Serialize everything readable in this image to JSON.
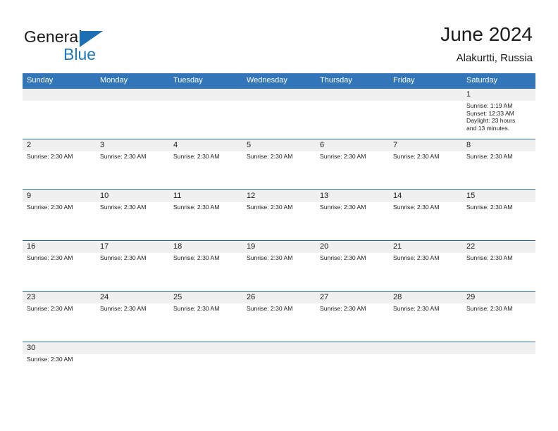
{
  "brand": {
    "name_part1": "General",
    "name_part2": "Blue",
    "logo_icon": "blue-triangle-logo"
  },
  "header": {
    "month_title": "June 2024",
    "location": "Alakurtti, Russia"
  },
  "colors": {
    "header_blue": "#3275b8",
    "row_divider_blue": "#2e6da4",
    "date_band_gray": "#f0f0f0",
    "brand_blue": "#1c7ac2",
    "text": "#1b1b1b"
  },
  "calendar": {
    "weekdays": [
      "Sunday",
      "Monday",
      "Tuesday",
      "Wednesday",
      "Thursday",
      "Friday",
      "Saturday"
    ],
    "weeks": [
      {
        "days": [
          {
            "date": "",
            "lines": []
          },
          {
            "date": "",
            "lines": []
          },
          {
            "date": "",
            "lines": []
          },
          {
            "date": "",
            "lines": []
          },
          {
            "date": "",
            "lines": []
          },
          {
            "date": "",
            "lines": []
          },
          {
            "date": "1",
            "lines": [
              "Sunrise: 1:19 AM",
              "Sunset: 12:33 AM",
              "Daylight: 23 hours",
              "and 13 minutes."
            ]
          }
        ]
      },
      {
        "days": [
          {
            "date": "2",
            "lines": [
              "Sunrise: 2:30 AM"
            ]
          },
          {
            "date": "3",
            "lines": [
              "Sunrise: 2:30 AM"
            ]
          },
          {
            "date": "4",
            "lines": [
              "Sunrise: 2:30 AM"
            ]
          },
          {
            "date": "5",
            "lines": [
              "Sunrise: 2:30 AM"
            ]
          },
          {
            "date": "6",
            "lines": [
              "Sunrise: 2:30 AM"
            ]
          },
          {
            "date": "7",
            "lines": [
              "Sunrise: 2:30 AM"
            ]
          },
          {
            "date": "8",
            "lines": [
              "Sunrise: 2:30 AM"
            ]
          }
        ]
      },
      {
        "days": [
          {
            "date": "9",
            "lines": [
              "Sunrise: 2:30 AM"
            ]
          },
          {
            "date": "10",
            "lines": [
              "Sunrise: 2:30 AM"
            ]
          },
          {
            "date": "11",
            "lines": [
              "Sunrise: 2:30 AM"
            ]
          },
          {
            "date": "12",
            "lines": [
              "Sunrise: 2:30 AM"
            ]
          },
          {
            "date": "13",
            "lines": [
              "Sunrise: 2:30 AM"
            ]
          },
          {
            "date": "14",
            "lines": [
              "Sunrise: 2:30 AM"
            ]
          },
          {
            "date": "15",
            "lines": [
              "Sunrise: 2:30 AM"
            ]
          }
        ]
      },
      {
        "days": [
          {
            "date": "16",
            "lines": [
              "Sunrise: 2:30 AM"
            ]
          },
          {
            "date": "17",
            "lines": [
              "Sunrise: 2:30 AM"
            ]
          },
          {
            "date": "18",
            "lines": [
              "Sunrise: 2:30 AM"
            ]
          },
          {
            "date": "19",
            "lines": [
              "Sunrise: 2:30 AM"
            ]
          },
          {
            "date": "20",
            "lines": [
              "Sunrise: 2:30 AM"
            ]
          },
          {
            "date": "21",
            "lines": [
              "Sunrise: 2:30 AM"
            ]
          },
          {
            "date": "22",
            "lines": [
              "Sunrise: 2:30 AM"
            ]
          }
        ]
      },
      {
        "days": [
          {
            "date": "23",
            "lines": [
              "Sunrise: 2:30 AM"
            ]
          },
          {
            "date": "24",
            "lines": [
              "Sunrise: 2:30 AM"
            ]
          },
          {
            "date": "25",
            "lines": [
              "Sunrise: 2:30 AM"
            ]
          },
          {
            "date": "26",
            "lines": [
              "Sunrise: 2:30 AM"
            ]
          },
          {
            "date": "27",
            "lines": [
              "Sunrise: 2:30 AM"
            ]
          },
          {
            "date": "28",
            "lines": [
              "Sunrise: 2:30 AM"
            ]
          },
          {
            "date": "29",
            "lines": [
              "Sunrise: 2:30 AM"
            ]
          }
        ]
      },
      {
        "days": [
          {
            "date": "30",
            "lines": [
              "Sunrise: 2:30 AM"
            ]
          },
          {
            "date": "",
            "lines": []
          },
          {
            "date": "",
            "lines": []
          },
          {
            "date": "",
            "lines": []
          },
          {
            "date": "",
            "lines": []
          },
          {
            "date": "",
            "lines": []
          },
          {
            "date": "",
            "lines": []
          }
        ]
      }
    ]
  }
}
